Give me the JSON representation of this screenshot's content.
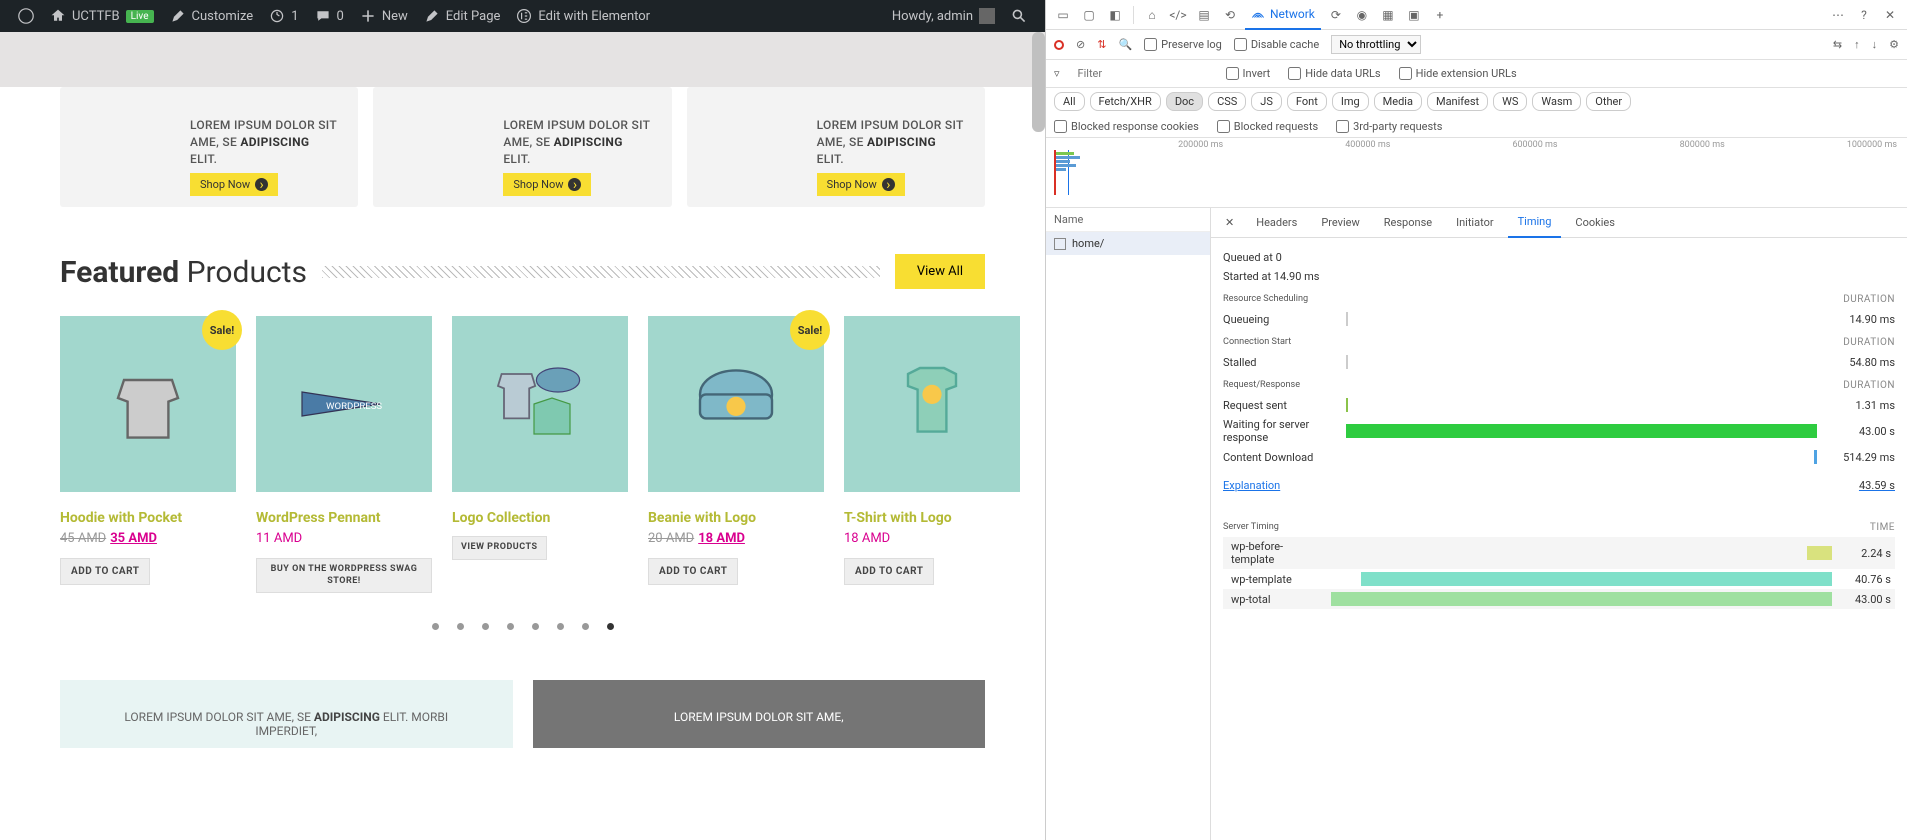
{
  "adminbar": {
    "site_name": "UCTTFB",
    "live_badge": "Live",
    "customize": "Customize",
    "updates": "1",
    "comments": "0",
    "new": "New",
    "edit_page": "Edit Page",
    "edit_elementor": "Edit with Elementor",
    "howdy": "Howdy, admin"
  },
  "promos": [
    {
      "text_a": "LOREM IPSUM DOLOR SIT AME, SE ",
      "text_b": "ADIPISCING",
      "text_c": " ELIT.",
      "btn": "Shop Now"
    },
    {
      "text_a": "LOREM IPSUM DOLOR SIT AME, SE ",
      "text_b": "ADIPISCING",
      "text_c": " ELIT.",
      "btn": "Shop Now"
    },
    {
      "text_a": "LOREM IPSUM DOLOR SIT AME, SE ",
      "text_b": "ADIPISCING",
      "text_c": " ELIT.",
      "btn": "Shop Now"
    }
  ],
  "featured": {
    "title_bold": "Featured",
    "title_rest": " Products",
    "view_all": "View All"
  },
  "sale_badge": "Sale!",
  "products": [
    {
      "name": "Hoodie with Pocket",
      "old": "45 AMD",
      "new": "35 AMD",
      "btn": "ADD TO CART",
      "sale": true
    },
    {
      "name": "WordPress Pennant",
      "price": "11 AMD",
      "btn": "BUY ON THE WORDPRESS SWAG STORE!",
      "wide": true
    },
    {
      "name": "Logo Collection",
      "btn": "VIEW PRODUCTS",
      "wide": true
    },
    {
      "name": "Beanie with Logo",
      "old": "20 AMD",
      "new": "18 AMD",
      "btn": "ADD TO CART",
      "sale": true
    },
    {
      "name": "T-Shirt with Logo",
      "price": "18 AMD",
      "btn": "ADD TO CART"
    }
  ],
  "banners": [
    {
      "a": "LOREM IPSUM DOLOR SIT AME, SE ",
      "b": "ADIPISCING",
      "c": " ELIT. MORBI IMPERDIET,"
    },
    {
      "a": "LOREM IPSUM DOLOR SIT AME,",
      "b": "",
      "c": ""
    }
  ],
  "devtools": {
    "tabs": {
      "network": "Network"
    },
    "sub1": {
      "preserve": "Preserve log",
      "disable": "Disable cache",
      "throttle": "No throttling"
    },
    "sub2": {
      "filter_ph": "Filter",
      "invert": "Invert",
      "hide_data": "Hide data URLs",
      "hide_ext": "Hide extension URLs"
    },
    "chips": [
      "All",
      "Fetch/XHR",
      "Doc",
      "CSS",
      "JS",
      "Font",
      "Img",
      "Media",
      "Manifest",
      "WS",
      "Wasm",
      "Other"
    ],
    "chips_active": "Doc",
    "sub3": {
      "blocked_cookies": "Blocked response cookies",
      "blocked_req": "Blocked requests",
      "third": "3rd-party requests"
    },
    "timeline_ticks": [
      "200000 ms",
      "400000 ms",
      "600000 ms",
      "800000 ms",
      "1000000 ms"
    ],
    "name_hdr": "Name",
    "request_name": "home/",
    "detail_tabs": [
      "Headers",
      "Preview",
      "Response",
      "Initiator",
      "Timing",
      "Cookies"
    ],
    "detail_active": "Timing",
    "timing": {
      "queued": "Queued at 0",
      "started": "Started at 14.90 ms",
      "resource_scheduling": "Resource Scheduling",
      "duration": "DURATION",
      "queueing": "Queueing",
      "queueing_v": "14.90 ms",
      "connection_start": "Connection Start",
      "stalled": "Stalled",
      "stalled_v": "54.80 ms",
      "request_response": "Request/Response",
      "req_sent": "Request sent",
      "req_sent_v": "1.31 ms",
      "waiting": "Waiting for server response",
      "waiting_v": "43.00 s",
      "download": "Content Download",
      "download_v": "514.29 ms",
      "explanation": "Explanation",
      "total": "43.59 s",
      "server_timing": "Server Timing",
      "time": "TIME",
      "server": [
        {
          "name": "wp-before-template",
          "v": "2.24 s"
        },
        {
          "name": "wp-template",
          "v": "40.76 s"
        },
        {
          "name": "wp-total",
          "v": "43.00 s"
        }
      ]
    }
  }
}
